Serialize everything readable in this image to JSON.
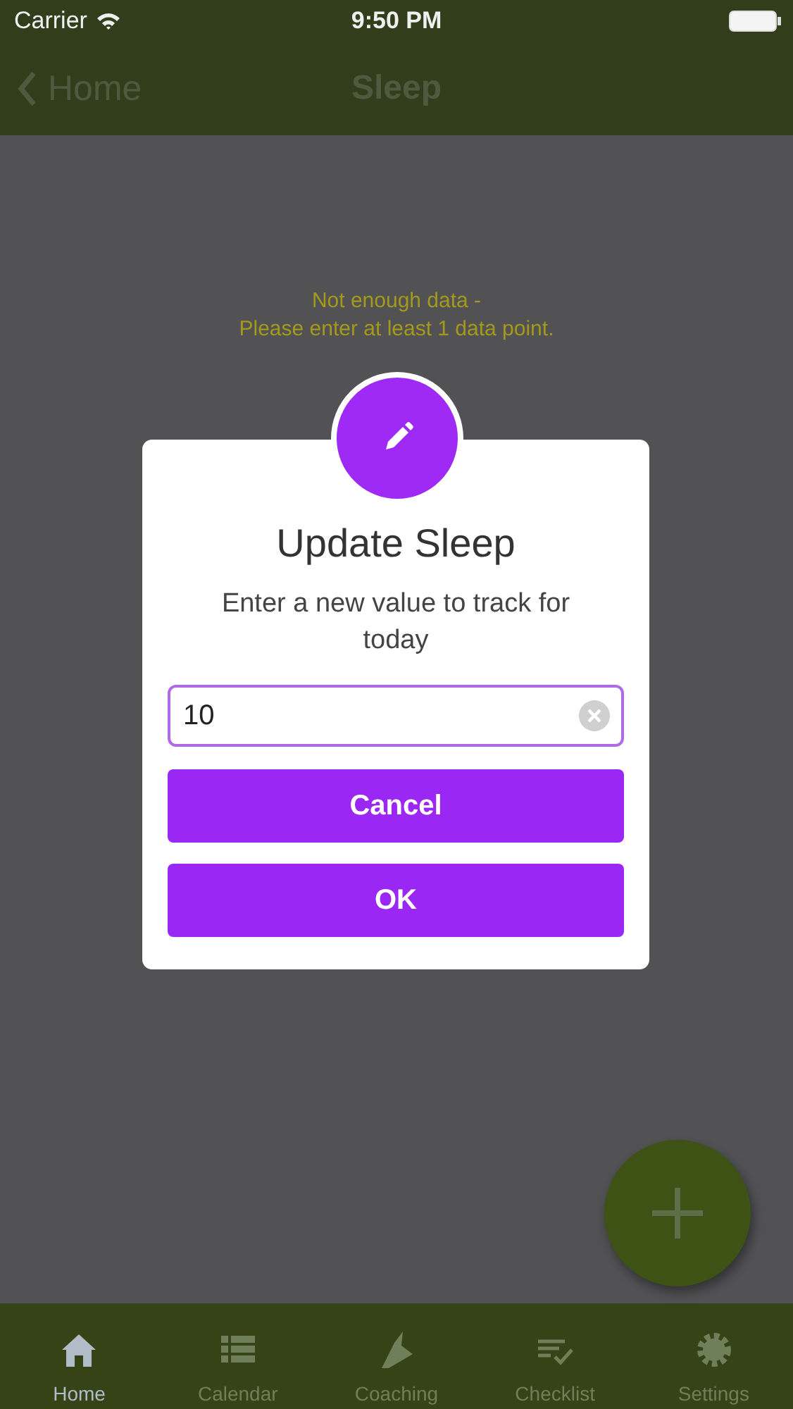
{
  "status_bar": {
    "carrier": "Carrier",
    "time": "9:50 PM"
  },
  "nav_bar": {
    "back": "Home",
    "title": "Sleep"
  },
  "message": [
    "Not enough data -",
    "Please enter at least 1 data point."
  ],
  "dialog": {
    "title": "Update Sleep",
    "text": "Enter a new value to track for today",
    "value": "10",
    "buttons": [
      "Cancel",
      "OK"
    ]
  },
  "tabs": [
    {
      "label": "Home",
      "selected": true
    },
    {
      "label": "Calendar",
      "selected": false
    },
    {
      "label": "Coaching",
      "selected": false
    },
    {
      "label": "Checklist",
      "selected": false
    },
    {
      "label": "Settings",
      "selected": false
    }
  ]
}
